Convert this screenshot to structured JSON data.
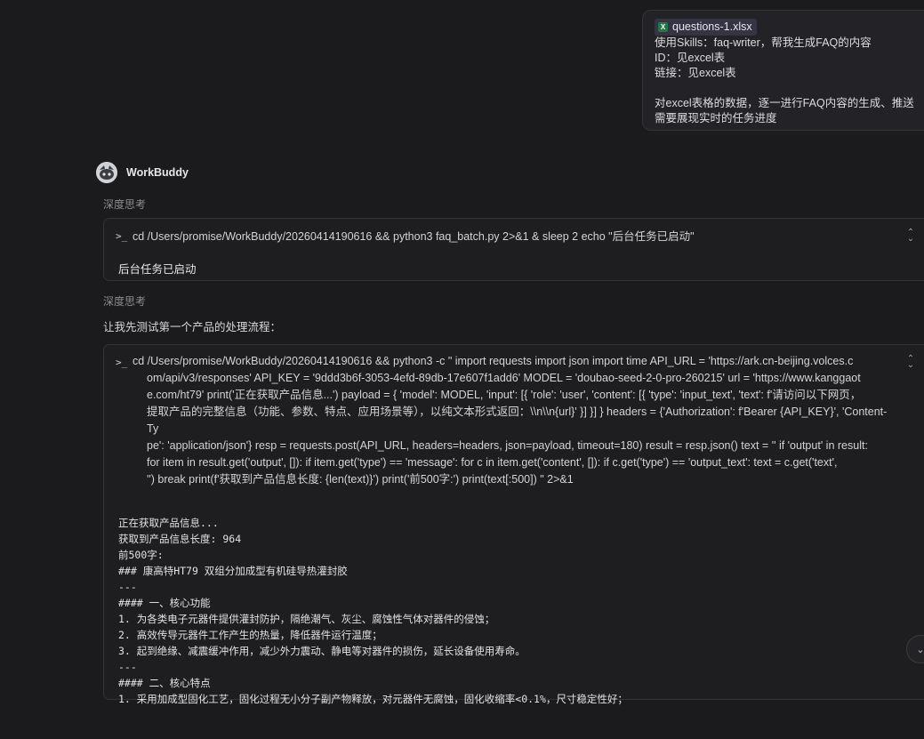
{
  "user_message": {
    "attachment": "questions-1.xlsx",
    "lines": [
      "使用Skills：faq-writer，帮我生成FAQ的内容",
      "ID：见excel表",
      "链接：见excel表",
      "",
      "对excel表格的数据，逐一进行FAQ内容的生成、推送",
      "需要展现实时的任务进度"
    ]
  },
  "assistant": {
    "name": "WorkBuddy",
    "thinking_label": "深度思考",
    "step1": {
      "command": "cd /Users/promise/WorkBuddy/20260414190616 && python3 faq_batch.py 2>&1 & sleep 2 echo \"后台任务已启动\"",
      "output": "后台任务已启动"
    },
    "lead_text": "让我先测试第一个产品的处理流程：",
    "step2": {
      "command_lines": [
        "cd /Users/promise/WorkBuddy/20260414190616 && python3 -c \" import requests import json import time API_URL = 'https://ark.cn-beijing.volces.c",
        "om/api/v3/responses' API_KEY = '9ddd3b6f-3053-4efd-89db-17e607f1add6' MODEL = 'doubao-seed-2-0-pro-260215' url = 'https://www.kanggaot",
        "e.com/ht79' print('正在获取产品信息...') payload = { 'model': MODEL, 'input': [{ 'role': 'user', 'content': [{ 'type': 'input_text', 'text': f'请访问以下网页，",
        "提取产品的完整信息（功能、参数、特点、应用场景等），以纯文本形式返回：\\\\n\\\\n{url}' }] }] } headers = {'Authorization': f'Bearer {API_KEY}', 'Content-Ty",
        "pe': 'application/json'} resp = requests.post(API_URL, headers=headers, json=payload, timeout=180) result = resp.json() text = '' if 'output' in result:",
        "for item in result.get('output', []): if item.get('type') == 'message': for c in item.get('content', []): if c.get('type') == 'output_text': text = c.get('text',",
        "'') break print(f'获取到产品信息长度: {len(text)}') print('前500字:') print(text[:500]) \" 2>&1"
      ],
      "output_lines": [
        "正在获取产品信息...",
        "获取到产品信息长度: 964",
        "前500字:",
        "### 康高特HT79 双组分加成型有机硅导热灌封胶",
        "---",
        "#### 一、核心功能",
        "1. 为各类电子元器件提供灌封防护，隔绝潮气、灰尘、腐蚀性气体对器件的侵蚀；",
        "2. 高效传导元器件工作产生的热量，降低器件运行温度；",
        "3. 起到绝缘、减震缓冲作用，减少外力震动、静电等对器件的损伤，延长设备使用寿命。",
        "---",
        "#### 二、核心特点",
        "1. 采用加成型固化工艺，固化过程无小分子副产物释放，对元器件无腐蚀，固化收缩率<0.1%，尺寸稳定性好；"
      ]
    }
  }
}
